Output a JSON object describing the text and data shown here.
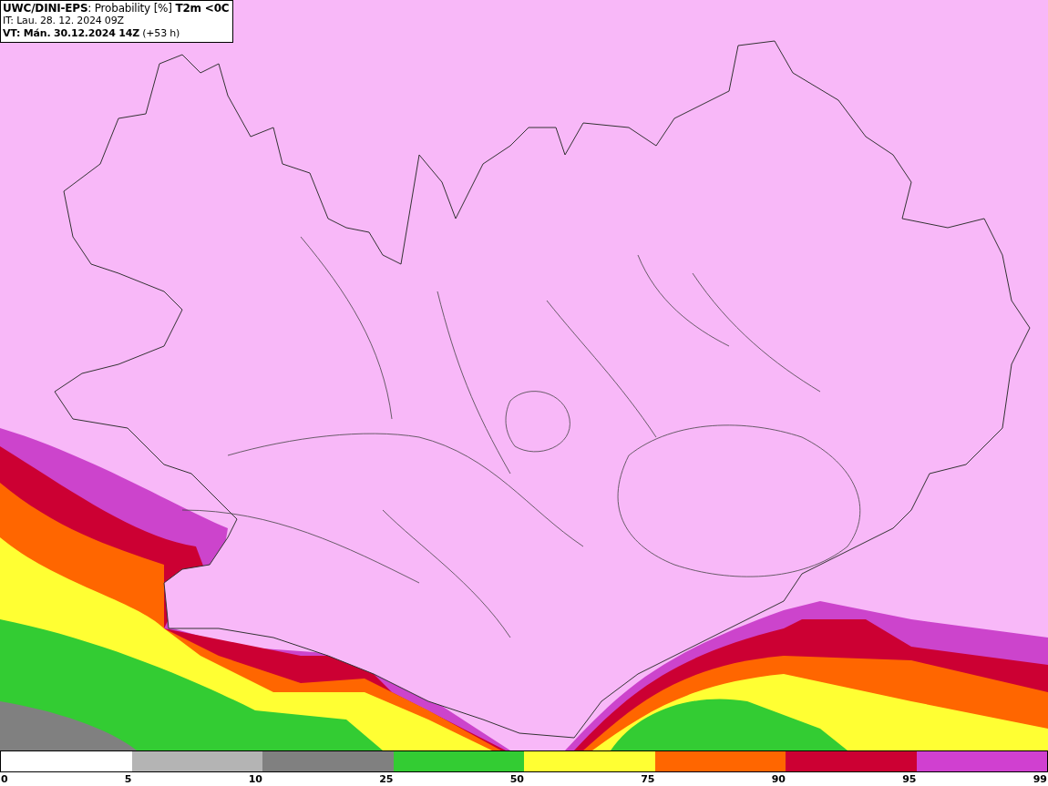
{
  "header": {
    "lines": [
      "**UWC/DINI-EPS**: Probability [%] **T2m <0C**",
      "IT: Lau. 28. 12. 2024 09Z",
      "**VT: Mán. 30.12.2024 14Z** (+53 h)"
    ]
  },
  "legend": {
    "segments": [
      {
        "color": "#ffffff"
      },
      {
        "color": "#b4b4b4"
      },
      {
        "color": "#808080"
      },
      {
        "color": "#33cc33"
      },
      {
        "color": "#ffff33"
      },
      {
        "color": "#ff6600"
      },
      {
        "color": "#cc0033"
      },
      {
        "color": "#d040d0"
      }
    ],
    "ticks": [
      "0",
      "5",
      "10",
      "25",
      "50",
      "75",
      "90",
      "95",
      "99"
    ]
  }
}
